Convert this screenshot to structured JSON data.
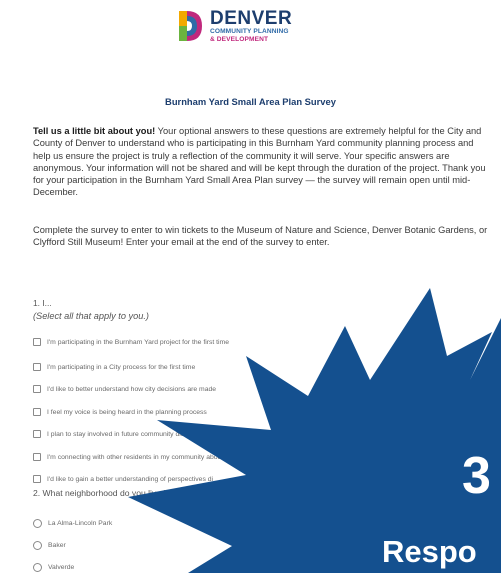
{
  "header": {
    "logo_name": "DENVER",
    "logo_sub_line1": "COMMUNITY PLANNING",
    "logo_sub_line2": "& DEVELOPMENT"
  },
  "survey": {
    "title": "Burnham Yard Small Area Plan Survey",
    "intro_bold": "Tell us a little bit about you!",
    "intro_text": " Your optional answers to these questions are extremely helpful for the City and County of Denver to understand who is participating in this Burnham Yard community planning process and help us ensure the project is truly a reflection of the community it will serve. Your specific answers are anonymous. Your information will not be shared and will be kept through the duration of the project. Thank you for your participation in the Burnham Yard Small Area Plan survey — the survey will remain open until mid-December.",
    "contest_text": "Complete the survey to enter to win tickets to the Museum of Nature and Science, Denver Botanic Gardens, or Clyfford Still Museum! Enter your email at the end of the survey to enter."
  },
  "question1": {
    "number": "1. I...",
    "hint": "(Select all that apply to you.)",
    "options": [
      "I'm participating in the Burnham Yard project for the first time",
      "I'm participating in a City process for the first time",
      "I'd like to better understand how city decisions are made",
      "I feel my voice is being heard in the planning process",
      "I plan to stay involved in future community discussions or projects",
      "I'm connecting with other residents in my community about the Burn",
      "I'd like to gain a better understanding of perspectives di"
    ]
  },
  "question2": {
    "text": "2. What neighborhood do you live in?",
    "options": [
      "La Alma-Lincoln Park",
      "Baker",
      "Valverde"
    ]
  },
  "overlay": {
    "big_number": "3",
    "big_word": "Respo"
  },
  "colors": {
    "brand_navy": "#1d3e6e",
    "brand_magenta": "#c0287d",
    "burst_blue": "#14508f"
  }
}
